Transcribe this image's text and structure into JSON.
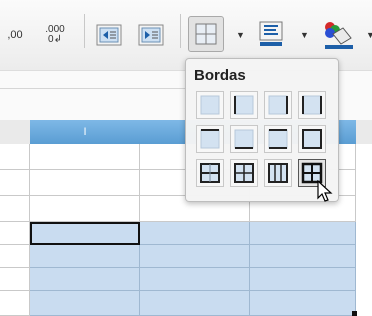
{
  "toolbar": {
    "decrease_decimal_label": ",00",
    "add_decimal_label_top": ".000",
    "add_decimal_label_bottom": "0↲",
    "icons": [
      "decimal-decrease",
      "decimal-add",
      "indent-decrease",
      "indent-increase",
      "borders",
      "border-color",
      "fill-color"
    ]
  },
  "sheet": {
    "column_header": "I"
  },
  "borders_popup": {
    "title": "Bordas",
    "options": [
      "no-borders",
      "left-border",
      "right-border",
      "left-right-borders",
      "top-border",
      "bottom-border",
      "top-bottom-borders",
      "outer-border",
      "horizontal-inner-borders",
      "outer-and-inner-borders",
      "vertical-inner-borders",
      "all-borders"
    ],
    "selected_option": "all-borders"
  },
  "colors": {
    "selection": "#c9dcf0",
    "header_highlight": "#5a9dd3",
    "border_color_accent": "#1d5fa8"
  }
}
